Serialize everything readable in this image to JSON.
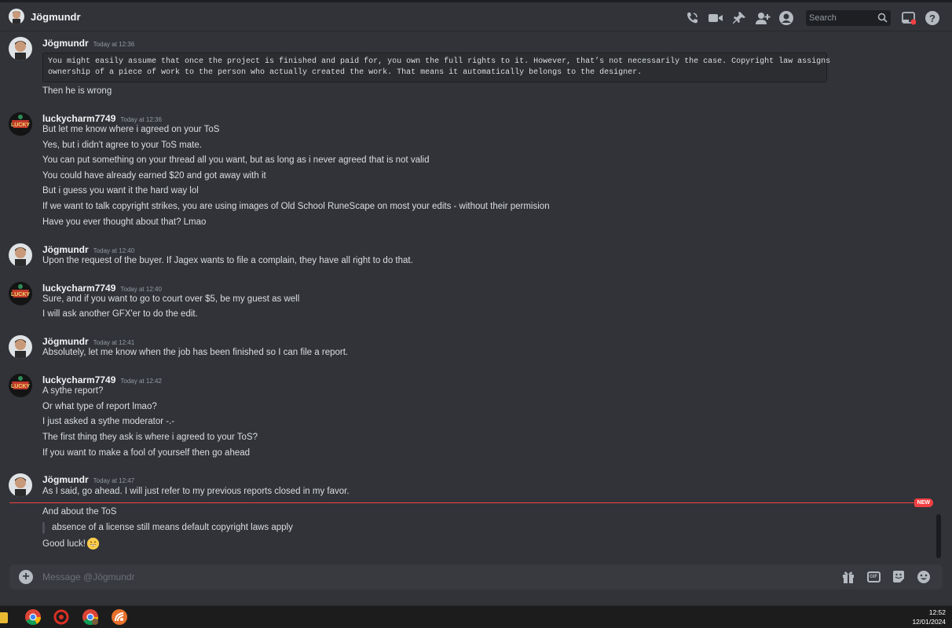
{
  "header": {
    "title": "Jögmundr",
    "search_placeholder": "Search",
    "icons": [
      "voice-call-icon",
      "video-call-icon",
      "pinned-messages-icon",
      "add-friend-icon",
      "user-profile-icon",
      "search-icon",
      "inbox-icon",
      "help-icon"
    ]
  },
  "messages": [
    {
      "author": "Jögmundr",
      "timestamp": "Today at 12:36",
      "code": "You might easily assume that once the project is finished and paid for, you own the full rights to it. However, that’s not necessarily the case. Copyright law assigns\nownership of a piece of work to the person who actually created the work. That means it automatically belongs to the designer.",
      "lines": [
        "Then he is wrong"
      ]
    },
    {
      "author": "luckycharm7749",
      "timestamp": "Today at 12:36",
      "lines": [
        "But let me know where i agreed on your ToS",
        "Yes, but i didn't agree to your ToS mate.",
        "You can put something on your thread all you want, but as long as i never agreed that is not valid",
        "You could have already earned $20 and got away with it",
        "But i guess you want it the hard way lol",
        "If we want to talk copyright strikes, you are using images of Old School RuneScape on most your edits - without their permision",
        "Have you ever thought about that? Lmao"
      ]
    },
    {
      "author": "Jögmundr",
      "timestamp": "Today at 12:40",
      "lines": [
        "Upon the request of the buyer. If Jagex wants to file a complain, they have all right to do that."
      ]
    },
    {
      "author": "luckycharm7749",
      "timestamp": "Today at 12:40",
      "lines": [
        "Sure, and if you want to go to court over $5, be my guest as well",
        "I will ask another GFX'er to do the edit."
      ]
    },
    {
      "author": "Jögmundr",
      "timestamp": "Today at 12:41",
      "lines": [
        "Absolutely, let me know when the job has been finished so I can file a report."
      ]
    },
    {
      "author": "luckycharm7749",
      "timestamp": "Today at 12:42",
      "lines": [
        "A sythe report?",
        "Or what type of report lmao?",
        "I just asked a sythe moderator -.-",
        "The first thing they ask is where i agreed to your ToS?",
        "If you want to make a fool of yourself then go ahead"
      ]
    },
    {
      "author": "Jögmundr",
      "timestamp": "Today at 12:47",
      "lines": [
        "As I said, go ahead. I will just refer to my previous reports closed in my favor."
      ],
      "after_divider": [
        "And about the ToS"
      ],
      "quote": "absence of a license still means default copyright laws apply",
      "final": "Good luck!"
    }
  ],
  "new_badge": "NEW",
  "composer": {
    "placeholder": "Message @Jögmundr",
    "gif_label": "GIF"
  },
  "taskbar": {
    "time": "12:52",
    "date": "12/01/2024"
  },
  "colors": {
    "background": "#313338",
    "new_divider": "#f23f43",
    "username": "#f2f3f5"
  }
}
